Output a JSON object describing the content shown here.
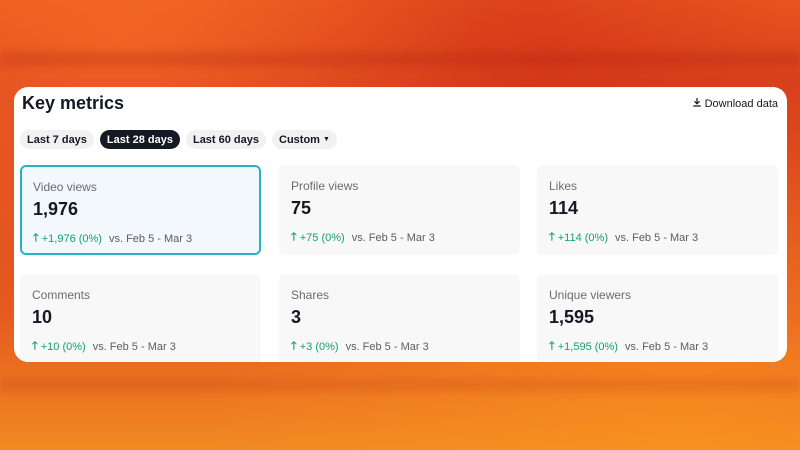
{
  "panel": {
    "title": "Key metrics",
    "download_label": "Download data",
    "download_icon": "download-icon"
  },
  "date_filters": [
    {
      "label": "Last 7 days",
      "active": false
    },
    {
      "label": "Last 28 days",
      "active": true
    },
    {
      "label": "Last 60 days",
      "active": false
    },
    {
      "label": "Custom",
      "active": false,
      "has_dropdown": true
    }
  ],
  "metrics": [
    {
      "label": "Video views",
      "value": "1,976",
      "change": "+1,976 (0%)",
      "comparison": "vs. Feb 5 - Mar 3",
      "selected": true
    },
    {
      "label": "Profile views",
      "value": "75",
      "change": "+75 (0%)",
      "comparison": "vs. Feb 5 - Mar 3",
      "selected": false
    },
    {
      "label": "Likes",
      "value": "114",
      "change": "+114 (0%)",
      "comparison": "vs. Feb 5 - Mar 3",
      "selected": false
    },
    {
      "label": "Comments",
      "value": "10",
      "change": "+10 (0%)",
      "comparison": "vs. Feb 5 - Mar 3",
      "selected": false
    },
    {
      "label": "Shares",
      "value": "3",
      "change": "+3 (0%)",
      "comparison": "vs. Feb 5 - Mar 3",
      "selected": false
    },
    {
      "label": "Unique viewers",
      "value": "1,595",
      "change": "+1,595 (0%)",
      "comparison": "vs. Feb 5 - Mar 3",
      "selected": false
    }
  ],
  "colors": {
    "positive": "#13a26b",
    "selected_border": "#25b4c4",
    "active_chip": "#161823"
  }
}
